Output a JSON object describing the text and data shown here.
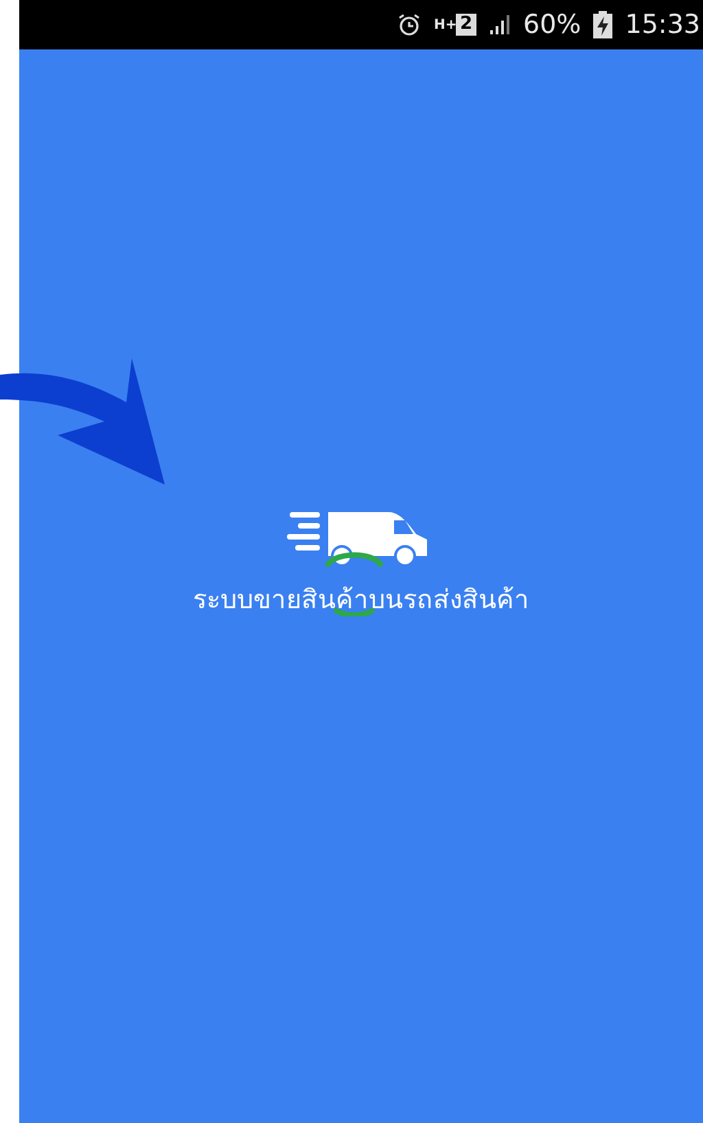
{
  "status_bar": {
    "network": "H+",
    "sim": "2",
    "battery": "60%",
    "time": "15:33"
  },
  "splash": {
    "app_name": "ระบบขายสินค้าบนรถส่งสินค้า",
    "loading": true
  }
}
